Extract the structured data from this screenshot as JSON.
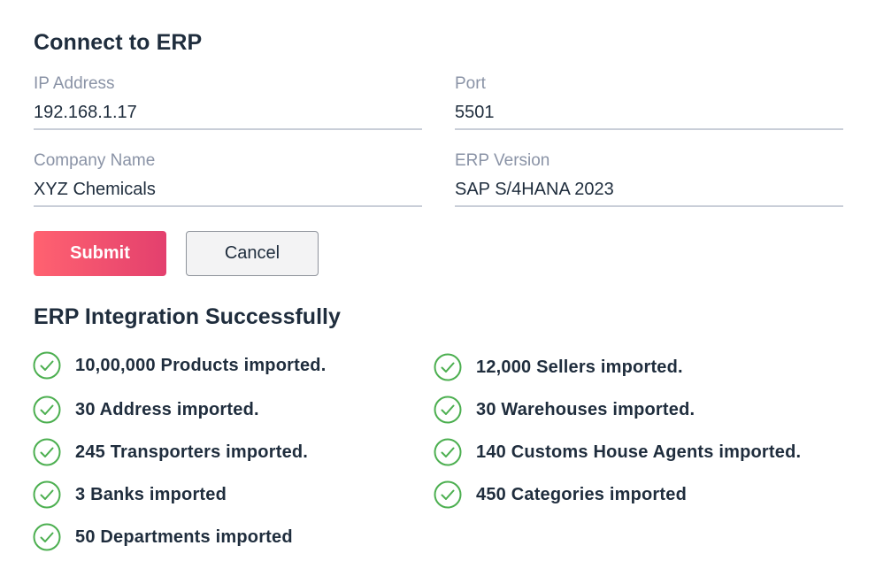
{
  "form": {
    "title": "Connect to ERP",
    "fields": [
      {
        "label": "IP Address",
        "value": "192.168.1.17"
      },
      {
        "label": "Port",
        "value": "5501"
      },
      {
        "label": "Company Name",
        "value": "XYZ Chemicals"
      },
      {
        "label": "ERP Version",
        "value": "SAP S/4HANA 2023"
      }
    ],
    "submit_label": "Submit",
    "cancel_label": "Cancel"
  },
  "result": {
    "title": "ERP Integration Successfully",
    "items_left": [
      "10,00,000 Products imported.",
      "30 Address imported.",
      "245 Transporters imported.",
      "3 Banks imported",
      "50 Departments imported"
    ],
    "items_right": [
      "12,000 Sellers imported.",
      "30 Warehouses imported.",
      "140 Customs House Agents imported.",
      "450 Categories imported"
    ]
  },
  "colors": {
    "accent_start": "#ff6270",
    "accent_end": "#e3406e",
    "success": "#4caf50",
    "text": "#1f2d3d",
    "label": "#8a93a6"
  }
}
